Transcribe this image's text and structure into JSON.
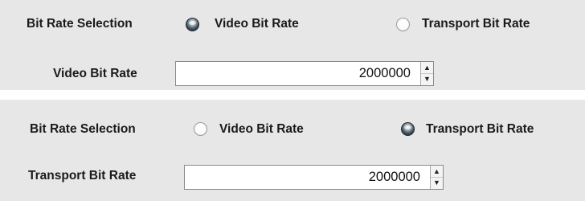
{
  "panel_video": {
    "selection_label": "Bit Rate Selection",
    "radio_video_label": "Video Bit Rate",
    "radio_transport_label": "Transport Bit Rate",
    "selected": "video",
    "field_label": "Video Bit Rate",
    "field_value": "2000000"
  },
  "panel_transport": {
    "selection_label": "Bit Rate Selection",
    "radio_video_label": "Video Bit Rate",
    "radio_transport_label": "Transport Bit Rate",
    "selected": "transport",
    "field_label": "Transport Bit Rate",
    "field_value": "2000000"
  },
  "icons": {
    "spin_up": "▲",
    "spin_down": "▼"
  },
  "colors": {
    "panel_background": "#e7e7e7",
    "radio_selected": "#2f3c46"
  }
}
